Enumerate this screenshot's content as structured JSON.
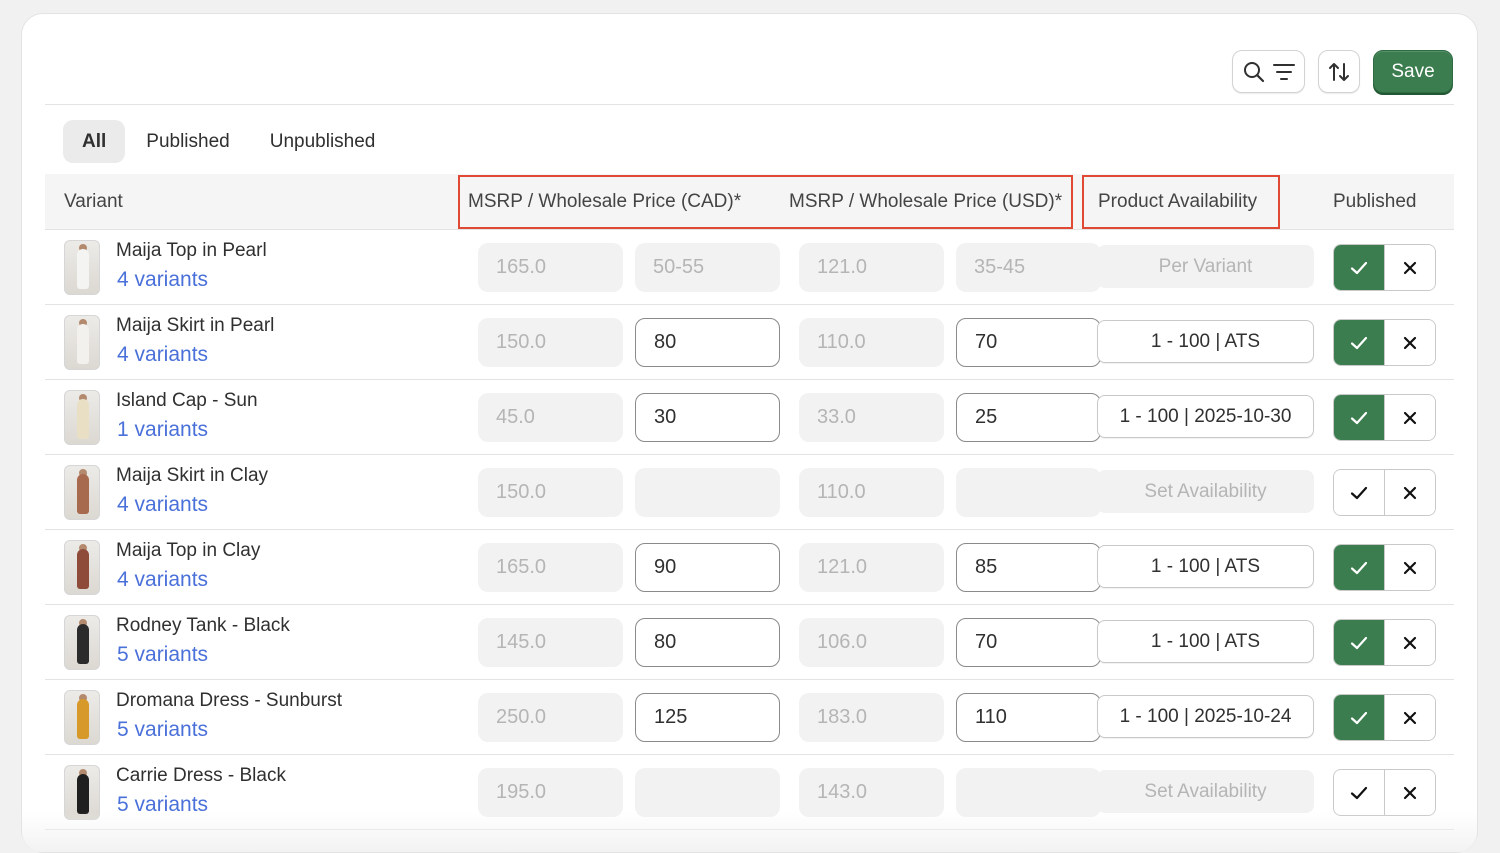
{
  "toolbar": {
    "search_icon": "search-icon",
    "filter_icon": "filter-lines-icon",
    "sort_icon": "sort-arrows-icon",
    "save_label": "Save"
  },
  "tabs": [
    {
      "label": "All",
      "active": true
    },
    {
      "label": "Published",
      "active": false
    },
    {
      "label": "Unpublished",
      "active": false
    }
  ],
  "columns": {
    "variant": "Variant",
    "price_cad": "MSRP / Wholesale Price (CAD)*",
    "price_usd": "MSRP / Wholesale Price (USD)*",
    "availability": "Product Availability",
    "published": "Published"
  },
  "colors": {
    "accent_green": "#3b7d4f",
    "link_blue": "#4a70d9",
    "highlight_red": "#e04a35"
  },
  "rows": [
    {
      "name": "Maija Top in Pearl",
      "variants": "4 variants",
      "msrp_cad": "165.0",
      "wholesale_cad": "50-55",
      "msrp_usd": "121.0",
      "wholesale_usd": "35-45",
      "wholesale_editable": false,
      "availability": "Per Variant",
      "availability_state": "disabled",
      "published": true,
      "thumb_color": "#f4f4f2"
    },
    {
      "name": "Maija Skirt in Pearl",
      "variants": "4 variants",
      "msrp_cad": "150.0",
      "wholesale_cad": "80",
      "msrp_usd": "110.0",
      "wholesale_usd": "70",
      "wholesale_editable": true,
      "availability": "1 - 100 | ATS",
      "availability_state": "set",
      "published": true,
      "thumb_color": "#f2f1ee"
    },
    {
      "name": "Island Cap - Sun",
      "variants": "1 variants",
      "msrp_cad": "45.0",
      "wholesale_cad": "30",
      "msrp_usd": "33.0",
      "wholesale_usd": "25",
      "wholesale_editable": true,
      "availability": "1 - 100 | 2025-10-30",
      "availability_state": "set",
      "published": true,
      "thumb_color": "#e9dfc4"
    },
    {
      "name": "Maija Skirt in Clay",
      "variants": "4 variants",
      "msrp_cad": "150.0",
      "wholesale_cad": "",
      "msrp_usd": "110.0",
      "wholesale_usd": "",
      "wholesale_editable": false,
      "availability": "Set Availability",
      "availability_state": "disabled",
      "published": false,
      "thumb_color": "#a86a4e"
    },
    {
      "name": "Maija Top in Clay",
      "variants": "4 variants",
      "msrp_cad": "165.0",
      "wholesale_cad": "90",
      "msrp_usd": "121.0",
      "wholesale_usd": "85",
      "wholesale_editable": true,
      "availability": "1 - 100 | ATS",
      "availability_state": "set",
      "published": true,
      "thumb_color": "#8e4b3a"
    },
    {
      "name": "Rodney Tank - Black",
      "variants": "5 variants",
      "msrp_cad": "145.0",
      "wholesale_cad": "80",
      "msrp_usd": "106.0",
      "wholesale_usd": "70",
      "wholesale_editable": true,
      "availability": "1 - 100 | ATS",
      "availability_state": "set",
      "published": true,
      "thumb_color": "#2b2b2b"
    },
    {
      "name": "Dromana Dress - Sunburst",
      "variants": "5 variants",
      "msrp_cad": "250.0",
      "wholesale_cad": "125",
      "msrp_usd": "183.0",
      "wholesale_usd": "110",
      "wholesale_editable": true,
      "availability": "1 - 100 | 2025-10-24",
      "availability_state": "set",
      "published": true,
      "thumb_color": "#d79a2a"
    },
    {
      "name": "Carrie Dress - Black",
      "variants": "5 variants",
      "msrp_cad": "195.0",
      "wholesale_cad": "",
      "msrp_usd": "143.0",
      "wholesale_usd": "",
      "wholesale_editable": false,
      "availability": "Set Availability",
      "availability_state": "disabled",
      "published": false,
      "thumb_color": "#1f1f1f"
    }
  ]
}
